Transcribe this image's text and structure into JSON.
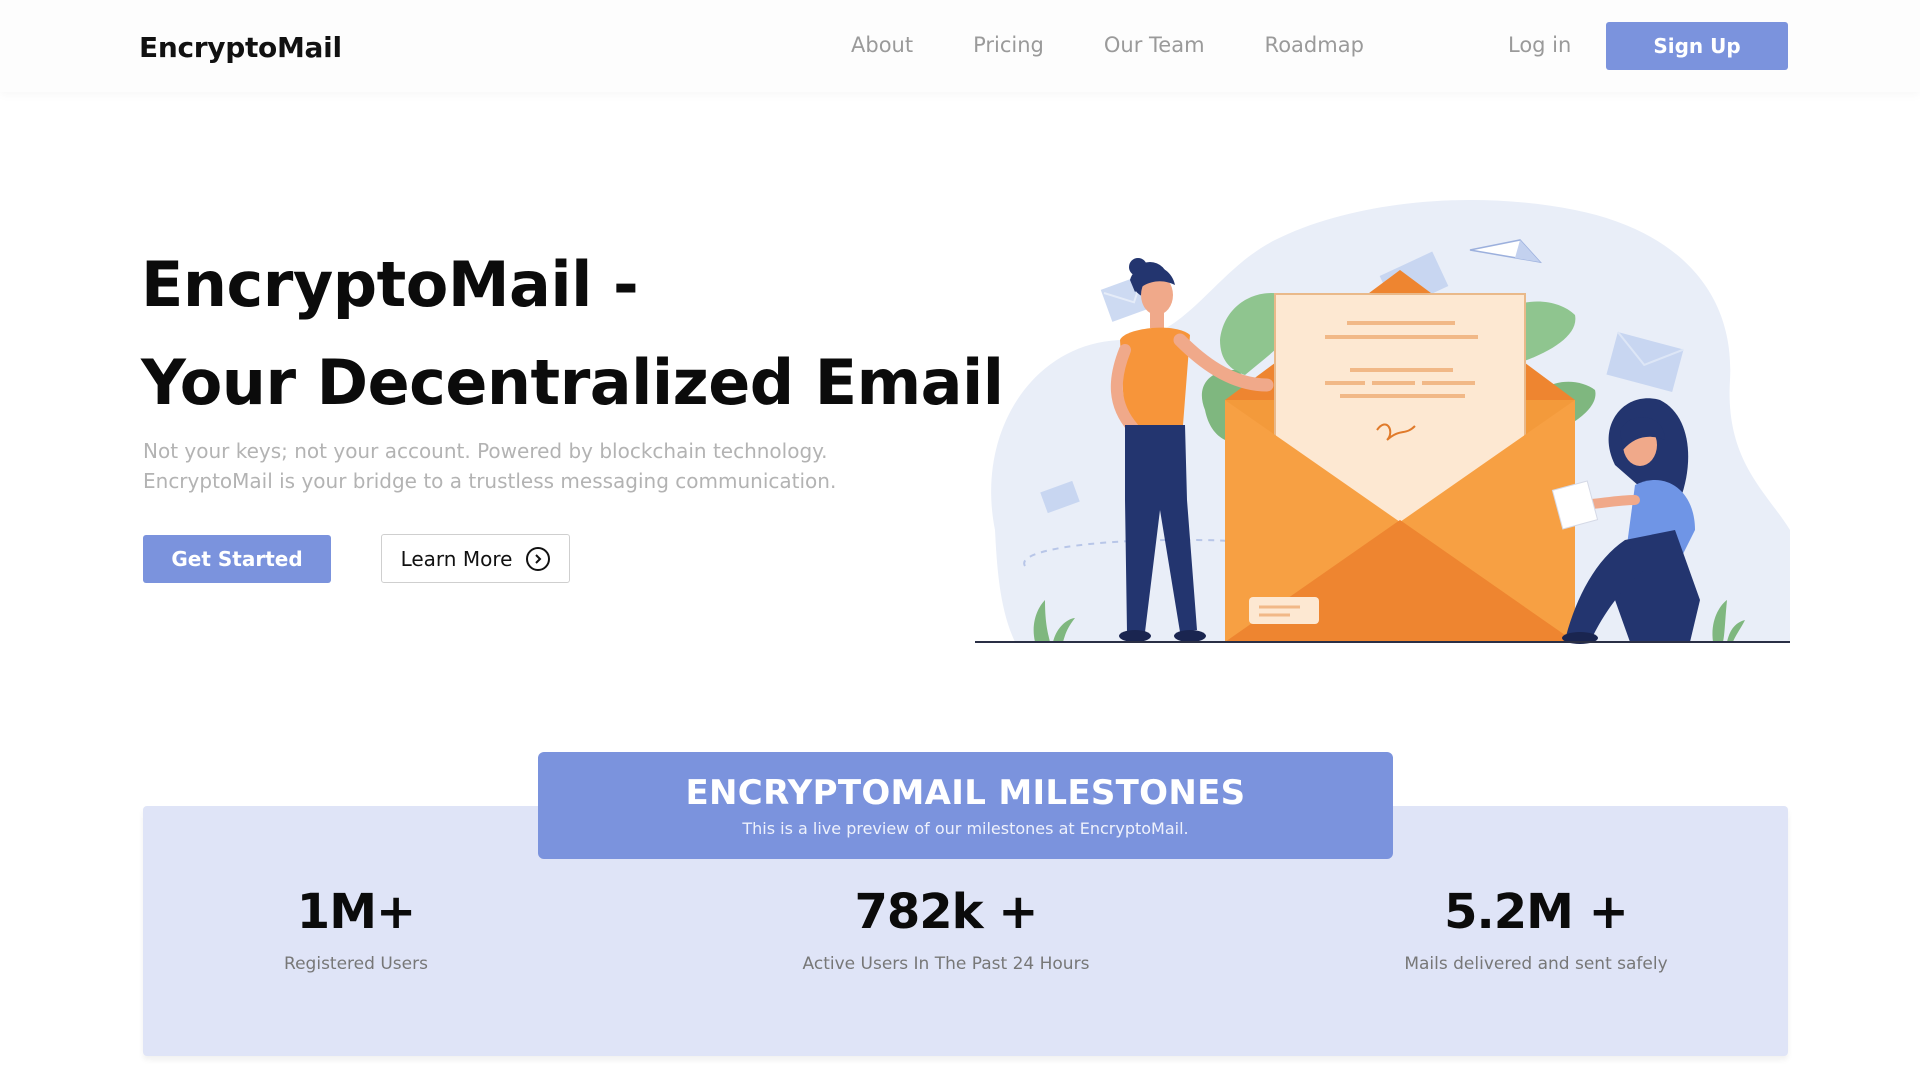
{
  "header": {
    "logo": "EncryptoMail",
    "nav": [
      "About",
      "Pricing",
      "Our Team",
      "Roadmap"
    ],
    "login": "Log in",
    "signup": "Sign Up"
  },
  "hero": {
    "title_line1": "EncryptoMail -",
    "title_line2": "Your Decentralized Email",
    "subtitle_line1": "Not your keys; not your account. Powered by blockchain technology.",
    "subtitle_line2": "EncryptoMail is your bridge to a trustless messaging communication.",
    "get_started": "Get Started",
    "learn_more": "Learn More",
    "learn_more_icon": "chevron-right-circle-icon"
  },
  "milestones": {
    "title": "ENCRYPTOMAIL MILESTONES",
    "subtitle": "This is a live preview of our milestones at EncryptoMail.",
    "stats": [
      {
        "value": "1M+",
        "label": "Registered Users"
      },
      {
        "value": "782k +",
        "label": "Active Users In The Past 24 Hours"
      },
      {
        "value": "5.2M +",
        "label": "Mails delivered and sent safely"
      }
    ]
  },
  "colors": {
    "accent": "#7b93dd",
    "panel": "#dfe4f7",
    "envelope": "#f39a3b",
    "leaf": "#8fc58f",
    "navy": "#23356f"
  }
}
